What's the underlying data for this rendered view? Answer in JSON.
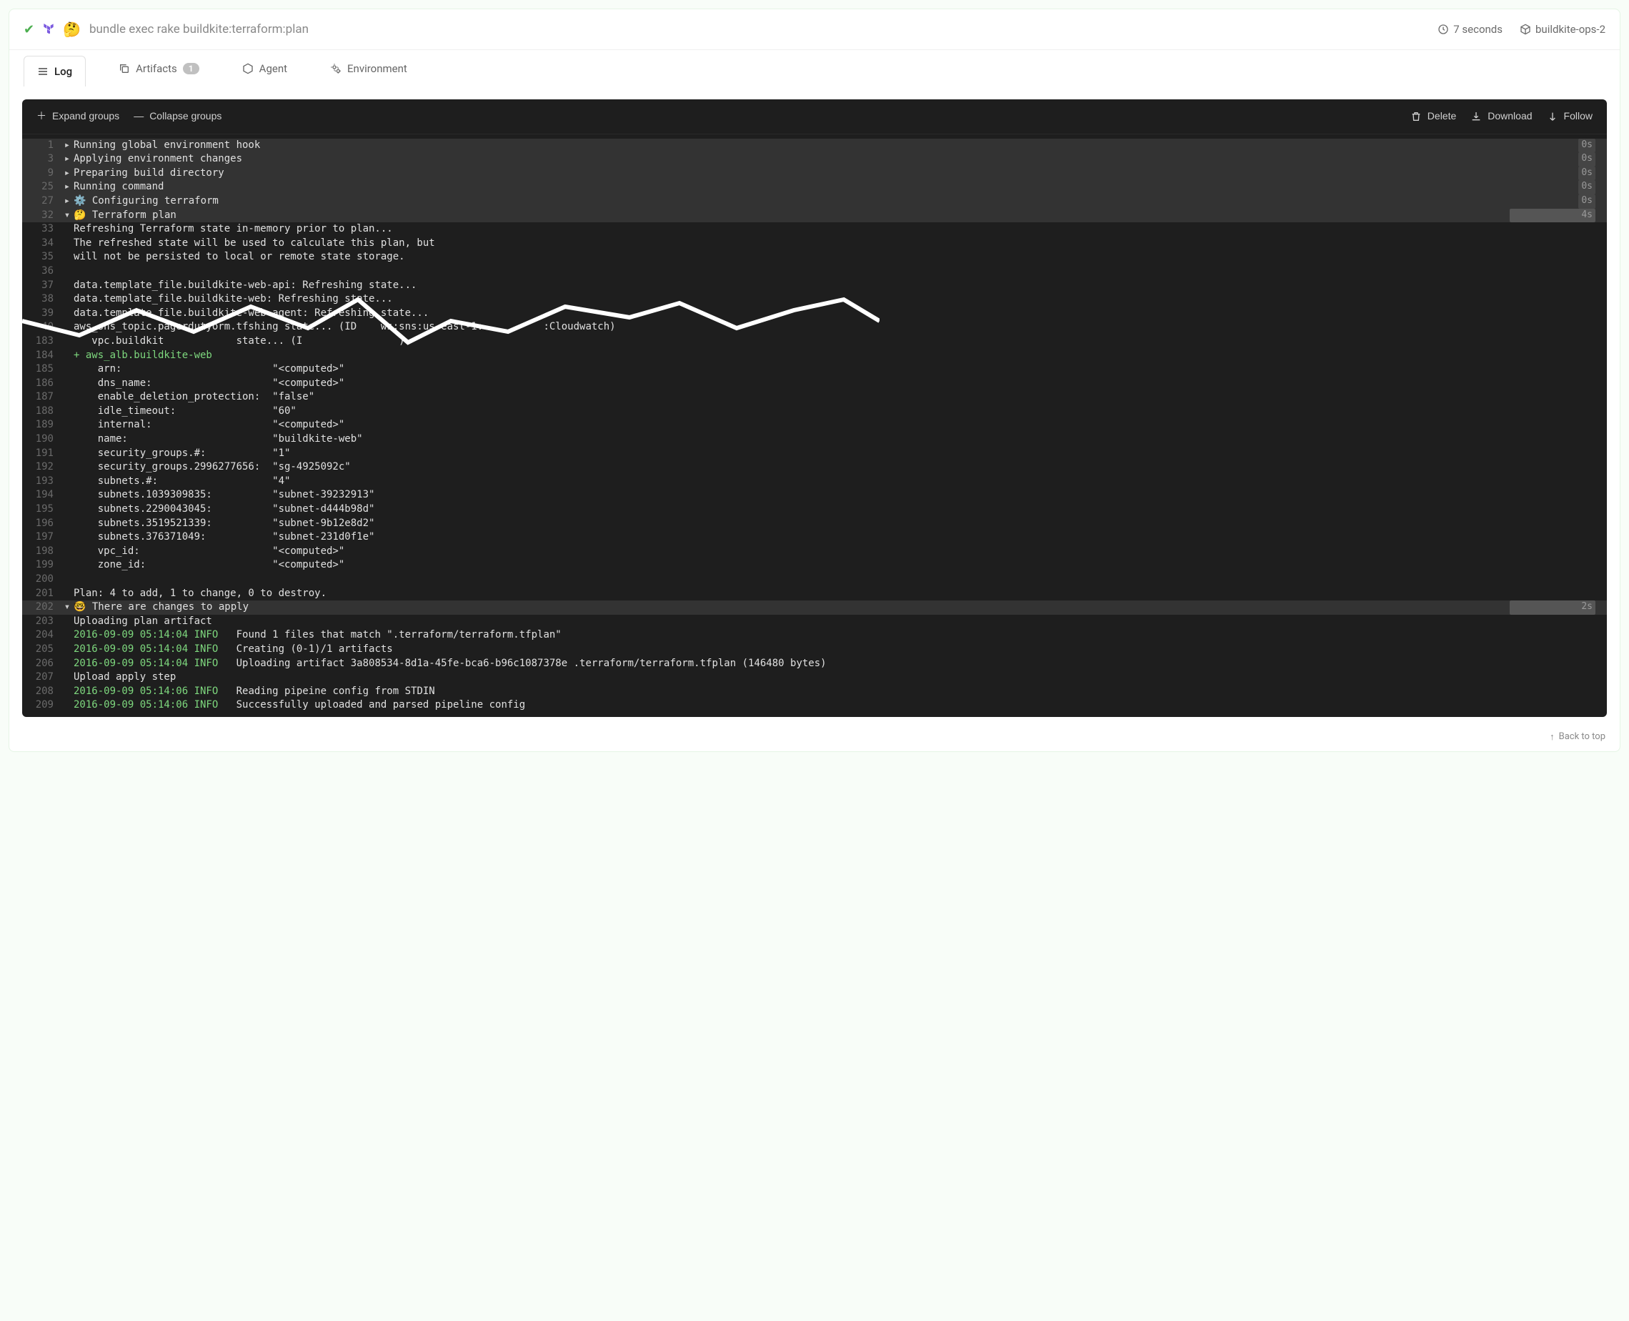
{
  "header": {
    "command": "bundle exec rake buildkite:terraform:plan",
    "duration": "7 seconds",
    "agent": "buildkite-ops-2"
  },
  "tabs": {
    "log": "Log",
    "artifacts": "Artifacts",
    "artifacts_count": "1",
    "agent": "Agent",
    "environment": "Environment"
  },
  "toolbar": {
    "expand": "Expand groups",
    "collapse": "Collapse groups",
    "delete": "Delete",
    "download": "Download",
    "follow": "Follow"
  },
  "log": {
    "groups": [
      {
        "num": "1",
        "label": "Running global environment hook",
        "time": "0s",
        "open": false
      },
      {
        "num": "3",
        "label": "Applying environment changes",
        "time": "0s",
        "open": false
      },
      {
        "num": "9",
        "label": "Preparing build directory",
        "time": "0s",
        "open": false
      },
      {
        "num": "25",
        "label": "Running command",
        "time": "0s",
        "open": false
      },
      {
        "num": "27",
        "label": "⚙️ Configuring terraform",
        "time": "0s",
        "open": false
      },
      {
        "num": "32",
        "label": "🤔 Terraform plan",
        "time": "4s",
        "open": true,
        "wide": true
      }
    ],
    "plan_lines": [
      {
        "num": "33",
        "text": "Refreshing Terraform state in-memory prior to plan..."
      },
      {
        "num": "34",
        "text": "The refreshed state will be used to calculate this plan, but"
      },
      {
        "num": "35",
        "text": "will not be persisted to local or remote state storage."
      },
      {
        "num": "36",
        "text": ""
      },
      {
        "num": "37",
        "text": "data.template_file.buildkite-web-api: Refreshing state..."
      },
      {
        "num": "38",
        "text": "data.template_file.buildkite-web: Refreshing state..."
      },
      {
        "num": "39",
        "text": "data.template_file.buildkite-web-agent: Refreshing state..."
      },
      {
        "num": "40",
        "text": "aws_sns_topic.pagerdutyorm.tfshing state... (ID    ws:sns:us-east-1:          :Cloudwatch)"
      },
      {
        "num": "183",
        "text": "   vpc.buildkit            state... (I                )"
      }
    ],
    "resource_header": {
      "num": "184",
      "text": "+ aws_alb.buildkite-web"
    },
    "resource_lines": [
      {
        "num": "185",
        "key": "arn:",
        "val": "\"<computed>\""
      },
      {
        "num": "186",
        "key": "dns_name:",
        "val": "\"<computed>\""
      },
      {
        "num": "187",
        "key": "enable_deletion_protection:",
        "val": "\"false\""
      },
      {
        "num": "188",
        "key": "idle_timeout:",
        "val": "\"60\""
      },
      {
        "num": "189",
        "key": "internal:",
        "val": "\"<computed>\""
      },
      {
        "num": "190",
        "key": "name:",
        "val": "\"buildkite-web\""
      },
      {
        "num": "191",
        "key": "security_groups.#:",
        "val": "\"1\""
      },
      {
        "num": "192",
        "key": "security_groups.2996277656:",
        "val": "\"sg-4925092c\""
      },
      {
        "num": "193",
        "key": "subnets.#:",
        "val": "\"4\""
      },
      {
        "num": "194",
        "key": "subnets.1039309835:",
        "val": "\"subnet-39232913\""
      },
      {
        "num": "195",
        "key": "subnets.2290043045:",
        "val": "\"subnet-d444b98d\""
      },
      {
        "num": "196",
        "key": "subnets.3519521339:",
        "val": "\"subnet-9b12e8d2\""
      },
      {
        "num": "197",
        "key": "subnets.376371049:",
        "val": "\"subnet-231d0f1e\""
      },
      {
        "num": "198",
        "key": "vpc_id:",
        "val": "\"<computed>\""
      },
      {
        "num": "199",
        "key": "zone_id:",
        "val": "\"<computed>\""
      }
    ],
    "blank_200": "200",
    "plan_summary": {
      "num": "201",
      "text": "Plan: 4 to add, 1 to change, 0 to destroy."
    },
    "changes_group": {
      "num": "202",
      "label": "🤓 There are changes to apply",
      "time": "2s"
    },
    "upload_header": {
      "num": "203",
      "text": "Uploading plan artifact"
    },
    "info_lines": [
      {
        "num": "204",
        "ts": "2016-09-09 05:14:04 INFO",
        "msg": "Found 1 files that match \".terraform/terraform.tfplan\""
      },
      {
        "num": "205",
        "ts": "2016-09-09 05:14:04 INFO",
        "msg": "Creating (0-1)/1 artifacts"
      },
      {
        "num": "206",
        "ts": "2016-09-09 05:14:04 INFO",
        "msg": "Uploading artifact 3a808534-8d1a-45fe-bca6-b96c1087378e .terraform/terraform.tfplan (146480 bytes)"
      }
    ],
    "upload_step": {
      "num": "207",
      "text": "Upload apply step"
    },
    "info_lines2": [
      {
        "num": "208",
        "ts": "2016-09-09 05:14:06 INFO",
        "msg": "Reading pipeine config from STDIN"
      },
      {
        "num": "209",
        "ts": "2016-09-09 05:14:06 INFO",
        "msg": "Successfully uploaded and parsed pipeline config"
      }
    ]
  },
  "footer": {
    "back_to_top": "Back to top"
  }
}
